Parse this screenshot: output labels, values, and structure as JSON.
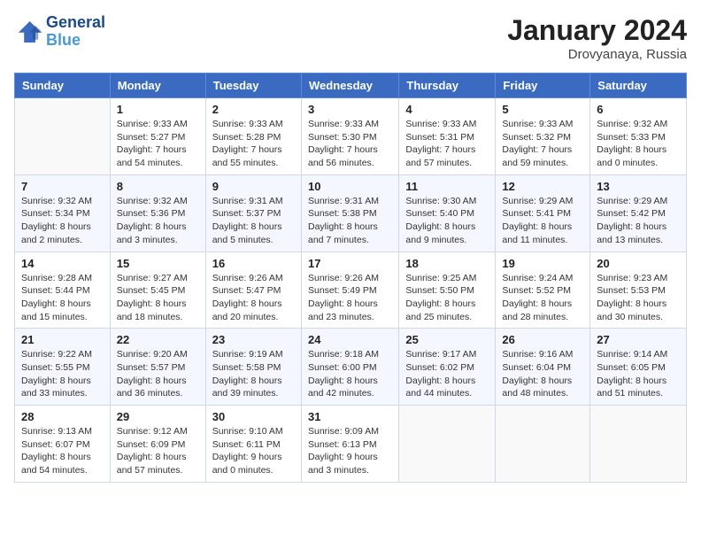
{
  "header": {
    "logo_line1": "General",
    "logo_line2": "Blue",
    "month_year": "January 2024",
    "location": "Drovyanaya, Russia"
  },
  "days_of_week": [
    "Sunday",
    "Monday",
    "Tuesday",
    "Wednesday",
    "Thursday",
    "Friday",
    "Saturday"
  ],
  "weeks": [
    [
      {
        "day": "",
        "info": ""
      },
      {
        "day": "1",
        "info": "Sunrise: 9:33 AM\nSunset: 5:27 PM\nDaylight: 7 hours\nand 54 minutes."
      },
      {
        "day": "2",
        "info": "Sunrise: 9:33 AM\nSunset: 5:28 PM\nDaylight: 7 hours\nand 55 minutes."
      },
      {
        "day": "3",
        "info": "Sunrise: 9:33 AM\nSunset: 5:30 PM\nDaylight: 7 hours\nand 56 minutes."
      },
      {
        "day": "4",
        "info": "Sunrise: 9:33 AM\nSunset: 5:31 PM\nDaylight: 7 hours\nand 57 minutes."
      },
      {
        "day": "5",
        "info": "Sunrise: 9:33 AM\nSunset: 5:32 PM\nDaylight: 7 hours\nand 59 minutes."
      },
      {
        "day": "6",
        "info": "Sunrise: 9:32 AM\nSunset: 5:33 PM\nDaylight: 8 hours\nand 0 minutes."
      }
    ],
    [
      {
        "day": "7",
        "info": "Sunrise: 9:32 AM\nSunset: 5:34 PM\nDaylight: 8 hours\nand 2 minutes."
      },
      {
        "day": "8",
        "info": "Sunrise: 9:32 AM\nSunset: 5:36 PM\nDaylight: 8 hours\nand 3 minutes."
      },
      {
        "day": "9",
        "info": "Sunrise: 9:31 AM\nSunset: 5:37 PM\nDaylight: 8 hours\nand 5 minutes."
      },
      {
        "day": "10",
        "info": "Sunrise: 9:31 AM\nSunset: 5:38 PM\nDaylight: 8 hours\nand 7 minutes."
      },
      {
        "day": "11",
        "info": "Sunrise: 9:30 AM\nSunset: 5:40 PM\nDaylight: 8 hours\nand 9 minutes."
      },
      {
        "day": "12",
        "info": "Sunrise: 9:29 AM\nSunset: 5:41 PM\nDaylight: 8 hours\nand 11 minutes."
      },
      {
        "day": "13",
        "info": "Sunrise: 9:29 AM\nSunset: 5:42 PM\nDaylight: 8 hours\nand 13 minutes."
      }
    ],
    [
      {
        "day": "14",
        "info": "Sunrise: 9:28 AM\nSunset: 5:44 PM\nDaylight: 8 hours\nand 15 minutes."
      },
      {
        "day": "15",
        "info": "Sunrise: 9:27 AM\nSunset: 5:45 PM\nDaylight: 8 hours\nand 18 minutes."
      },
      {
        "day": "16",
        "info": "Sunrise: 9:26 AM\nSunset: 5:47 PM\nDaylight: 8 hours\nand 20 minutes."
      },
      {
        "day": "17",
        "info": "Sunrise: 9:26 AM\nSunset: 5:49 PM\nDaylight: 8 hours\nand 23 minutes."
      },
      {
        "day": "18",
        "info": "Sunrise: 9:25 AM\nSunset: 5:50 PM\nDaylight: 8 hours\nand 25 minutes."
      },
      {
        "day": "19",
        "info": "Sunrise: 9:24 AM\nSunset: 5:52 PM\nDaylight: 8 hours\nand 28 minutes."
      },
      {
        "day": "20",
        "info": "Sunrise: 9:23 AM\nSunset: 5:53 PM\nDaylight: 8 hours\nand 30 minutes."
      }
    ],
    [
      {
        "day": "21",
        "info": "Sunrise: 9:22 AM\nSunset: 5:55 PM\nDaylight: 8 hours\nand 33 minutes."
      },
      {
        "day": "22",
        "info": "Sunrise: 9:20 AM\nSunset: 5:57 PM\nDaylight: 8 hours\nand 36 minutes."
      },
      {
        "day": "23",
        "info": "Sunrise: 9:19 AM\nSunset: 5:58 PM\nDaylight: 8 hours\nand 39 minutes."
      },
      {
        "day": "24",
        "info": "Sunrise: 9:18 AM\nSunset: 6:00 PM\nDaylight: 8 hours\nand 42 minutes."
      },
      {
        "day": "25",
        "info": "Sunrise: 9:17 AM\nSunset: 6:02 PM\nDaylight: 8 hours\nand 44 minutes."
      },
      {
        "day": "26",
        "info": "Sunrise: 9:16 AM\nSunset: 6:04 PM\nDaylight: 8 hours\nand 48 minutes."
      },
      {
        "day": "27",
        "info": "Sunrise: 9:14 AM\nSunset: 6:05 PM\nDaylight: 8 hours\nand 51 minutes."
      }
    ],
    [
      {
        "day": "28",
        "info": "Sunrise: 9:13 AM\nSunset: 6:07 PM\nDaylight: 8 hours\nand 54 minutes."
      },
      {
        "day": "29",
        "info": "Sunrise: 9:12 AM\nSunset: 6:09 PM\nDaylight: 8 hours\nand 57 minutes."
      },
      {
        "day": "30",
        "info": "Sunrise: 9:10 AM\nSunset: 6:11 PM\nDaylight: 9 hours\nand 0 minutes."
      },
      {
        "day": "31",
        "info": "Sunrise: 9:09 AM\nSunset: 6:13 PM\nDaylight: 9 hours\nand 3 minutes."
      },
      {
        "day": "",
        "info": ""
      },
      {
        "day": "",
        "info": ""
      },
      {
        "day": "",
        "info": ""
      }
    ]
  ]
}
